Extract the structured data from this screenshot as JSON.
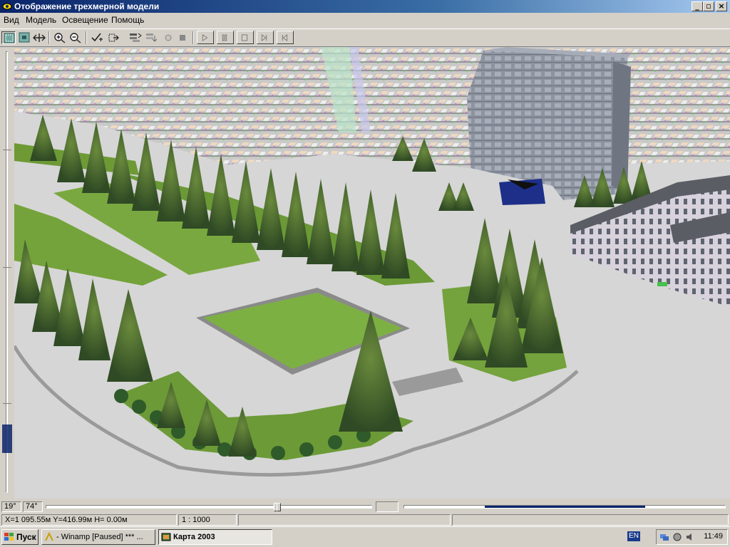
{
  "window": {
    "title": "Отображение трехмерной модели",
    "controls": {
      "minimize": "_",
      "maximize": "▫",
      "close": "×"
    }
  },
  "menu": [
    "Вид",
    "Модель",
    "Освещение",
    "Помощь"
  ],
  "toolbar": {
    "icons": [
      "select-frame-icon",
      "select-object-icon",
      "pan-icon",
      "zoom-in-icon",
      "zoom-out-icon",
      "check-transform-icon",
      "rotate-view-icon",
      "layers-icon",
      "layers-down-icon",
      "record-icon",
      "stop-square-icon"
    ],
    "playback": [
      "play-icon",
      "pause-icon",
      "stop-icon",
      "next-frame-icon",
      "first-frame-icon"
    ]
  },
  "view": {
    "tilt_angle": "19°",
    "rotation_angle": "74°"
  },
  "status": {
    "coordinates": "X=1 095.55м  Y=416.99м  H= 0.00м",
    "scale": "1 : 1000"
  },
  "taskbar": {
    "start": "Пуск",
    "tasks": [
      "- Winamp [Paused] *** ...",
      "Карта 2003"
    ],
    "language": "EN",
    "clock": "11:49"
  },
  "colors": {
    "titlebar_start": "#0a246a",
    "titlebar_end": "#a6caf0",
    "grass": "#7cab3a",
    "trees": "#3c5a2c",
    "pavement": "#d7d7d7",
    "building": "#8e95a1"
  }
}
